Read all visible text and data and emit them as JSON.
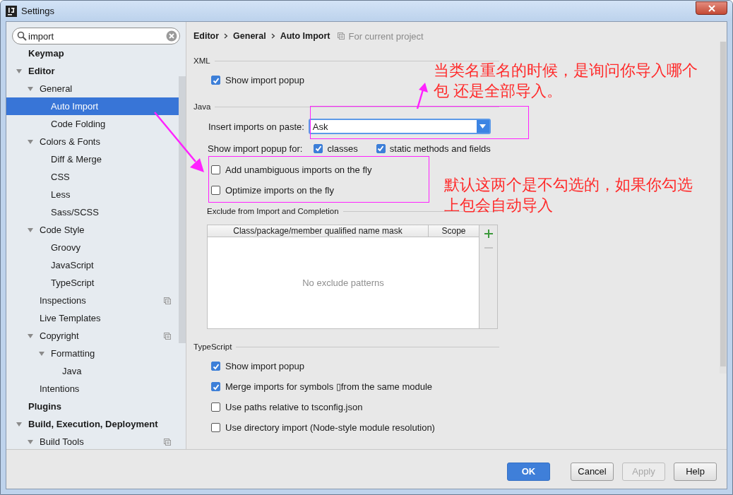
{
  "window": {
    "title": "Settings"
  },
  "search": {
    "value": "import"
  },
  "sidebar": {
    "items": [
      {
        "label": "Keymap",
        "selected": false
      },
      {
        "label": "Editor",
        "expanded": true,
        "selected": false,
        "children": [
          {
            "label": "General",
            "expanded": true,
            "selected": false,
            "children": [
              {
                "label": "Auto Import",
                "selected": true
              },
              {
                "label": "Code Folding",
                "selected": false
              }
            ]
          },
          {
            "label": "Colors & Fonts",
            "expanded": true,
            "selected": false,
            "children": [
              {
                "label": "Diff & Merge",
                "selected": false
              },
              {
                "label": "CSS",
                "selected": false
              },
              {
                "label": "Less",
                "selected": false
              },
              {
                "label": "Sass/SCSS",
                "selected": false
              }
            ]
          },
          {
            "label": "Code Style",
            "expanded": true,
            "selected": false,
            "children": [
              {
                "label": "Groovy",
                "selected": false
              },
              {
                "label": "JavaScript",
                "selected": false
              },
              {
                "label": "TypeScript",
                "selected": false
              }
            ]
          },
          {
            "label": "Inspections",
            "selected": false,
            "project_level": true
          },
          {
            "label": "Live Templates",
            "selected": false
          },
          {
            "label": "Copyright",
            "expanded": true,
            "selected": false,
            "project_level": true,
            "children": [
              {
                "label": "Formatting",
                "expanded": true,
                "selected": false,
                "children": [
                  {
                    "label": "Java",
                    "selected": false
                  }
                ]
              }
            ]
          },
          {
            "label": "Intentions",
            "selected": false
          }
        ]
      },
      {
        "label": "Plugins",
        "selected": false
      },
      {
        "label": "Build, Execution, Deployment",
        "expanded": true,
        "selected": false,
        "children": [
          {
            "label": "Build Tools",
            "expanded": true,
            "selected": false,
            "project_level": true
          }
        ]
      }
    ]
  },
  "breadcrumb": [
    "Editor",
    "General",
    "Auto Import"
  ],
  "scope_note": "For current project",
  "sections": [
    {
      "title": "XML",
      "rows": [
        {
          "kind": "checkbox",
          "label": "Show import popup",
          "checked": true
        }
      ]
    },
    {
      "title": "Java",
      "rows": [
        {
          "kind": "dropdown",
          "label": "Insert imports on paste:",
          "value": "Ask"
        },
        {
          "kind": "group",
          "label": "Show import popup for:",
          "options": [
            {
              "label": "classes",
              "checked": true
            },
            {
              "label": "static methods and fields",
              "checked": true
            }
          ]
        },
        {
          "kind": "checkbox",
          "label": "Add unambiguous imports on the fly",
          "checked": false
        },
        {
          "kind": "checkbox",
          "label": "Optimize imports on the fly",
          "checked": false
        },
        {
          "kind": "table",
          "title": "Exclude from Import and Completion",
          "columns": [
            "Class/package/member qualified name mask",
            "Scope"
          ],
          "empty_text": "No exclude patterns"
        }
      ]
    },
    {
      "title": "TypeScript",
      "rows": [
        {
          "kind": "checkbox",
          "label": "Show import popup",
          "checked": true
        },
        {
          "kind": "checkbox",
          "label": "Merge imports for symbols ▯from the same module",
          "checked": true
        },
        {
          "kind": "checkbox",
          "label": "Use paths relative to tsconfig.json",
          "checked": false
        },
        {
          "kind": "checkbox",
          "label": "Use directory import (Node-style module resolution)",
          "checked": false
        }
      ]
    }
  ],
  "buttons": [
    {
      "label": "OK",
      "kind": "primary",
      "disabled": false
    },
    {
      "label": "Cancel",
      "kind": "normal",
      "disabled": false
    },
    {
      "label": "Apply",
      "kind": "normal",
      "disabled": true
    },
    {
      "label": "Help",
      "kind": "normal",
      "disabled": false
    }
  ],
  "annotations": [
    {
      "text": "当类名重名的时候，是询问你导入哪个包 还是全部导入。"
    },
    {
      "text": "默认这两个是不勾选的，如果你勾选上包会自动导入"
    }
  ]
}
